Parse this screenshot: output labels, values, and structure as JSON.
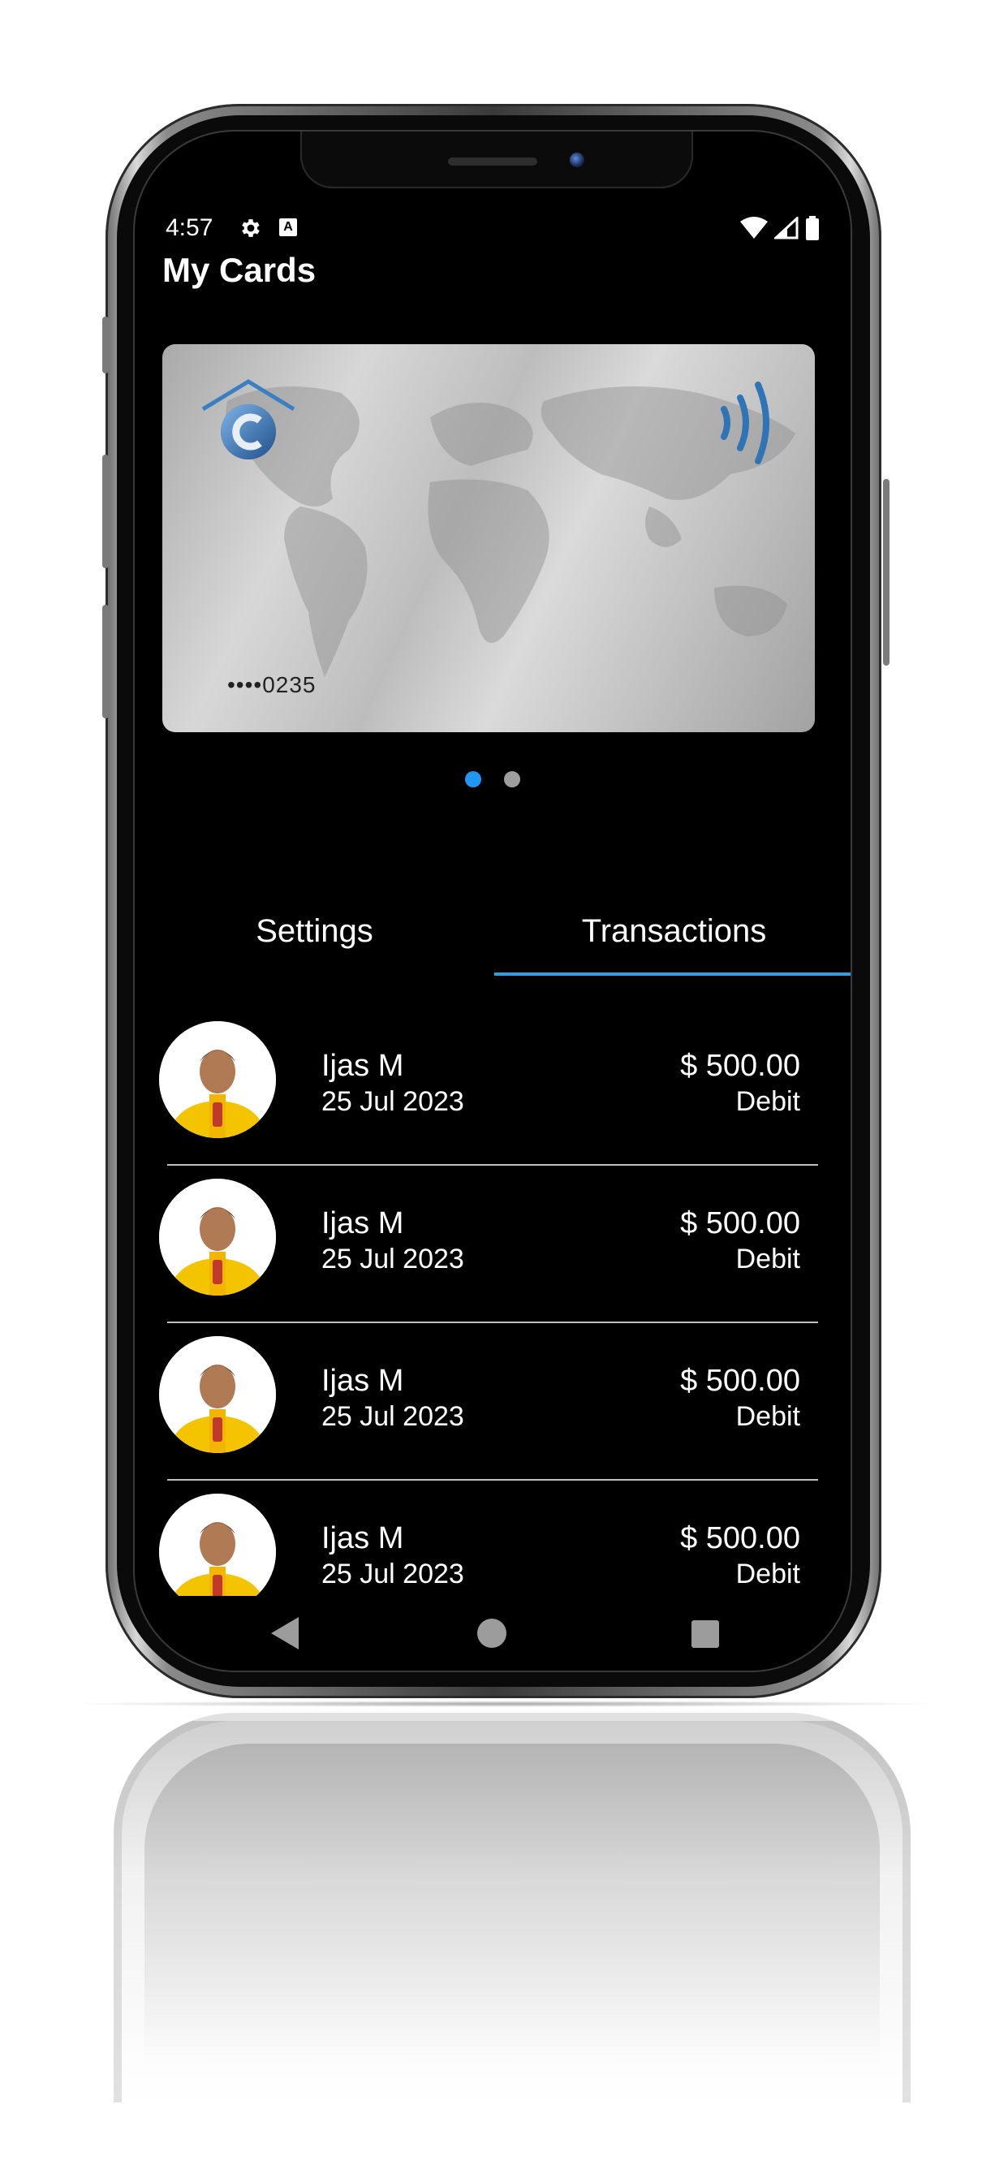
{
  "status_bar": {
    "time": "4:57",
    "icons": [
      "settings-gear-icon",
      "a-notification-icon",
      "wifi-icon",
      "cell-signal-icon",
      "battery-icon"
    ]
  },
  "header": {
    "title": "My Cards"
  },
  "card": {
    "number_masked": "••••0235",
    "brand_icon": "bank-logo-icon",
    "contactless_icon": "nfc-contactless-icon"
  },
  "pager": {
    "count": 2,
    "active_index": 0,
    "active_color": "#2196f3",
    "inactive_color": "#9e9e9e"
  },
  "tabs": [
    {
      "label": "Settings",
      "active": false
    },
    {
      "label": "Transactions",
      "active": true
    }
  ],
  "accent_color": "#3a9bd9",
  "transactions": [
    {
      "name": "Ijas M",
      "date": "25 Jul 2023",
      "amount": "$ 500.00",
      "type": "Debit"
    },
    {
      "name": "Ijas M",
      "date": "25 Jul 2023",
      "amount": "$ 500.00",
      "type": "Debit"
    },
    {
      "name": "Ijas M",
      "date": "25 Jul 2023",
      "amount": "$ 500.00",
      "type": "Debit"
    },
    {
      "name": "Ijas M",
      "date": "25 Jul 2023",
      "amount": "$ 500.00",
      "type": "Debit"
    }
  ],
  "nav_bar": {
    "icons": [
      "back-icon",
      "home-icon",
      "recents-icon"
    ]
  }
}
